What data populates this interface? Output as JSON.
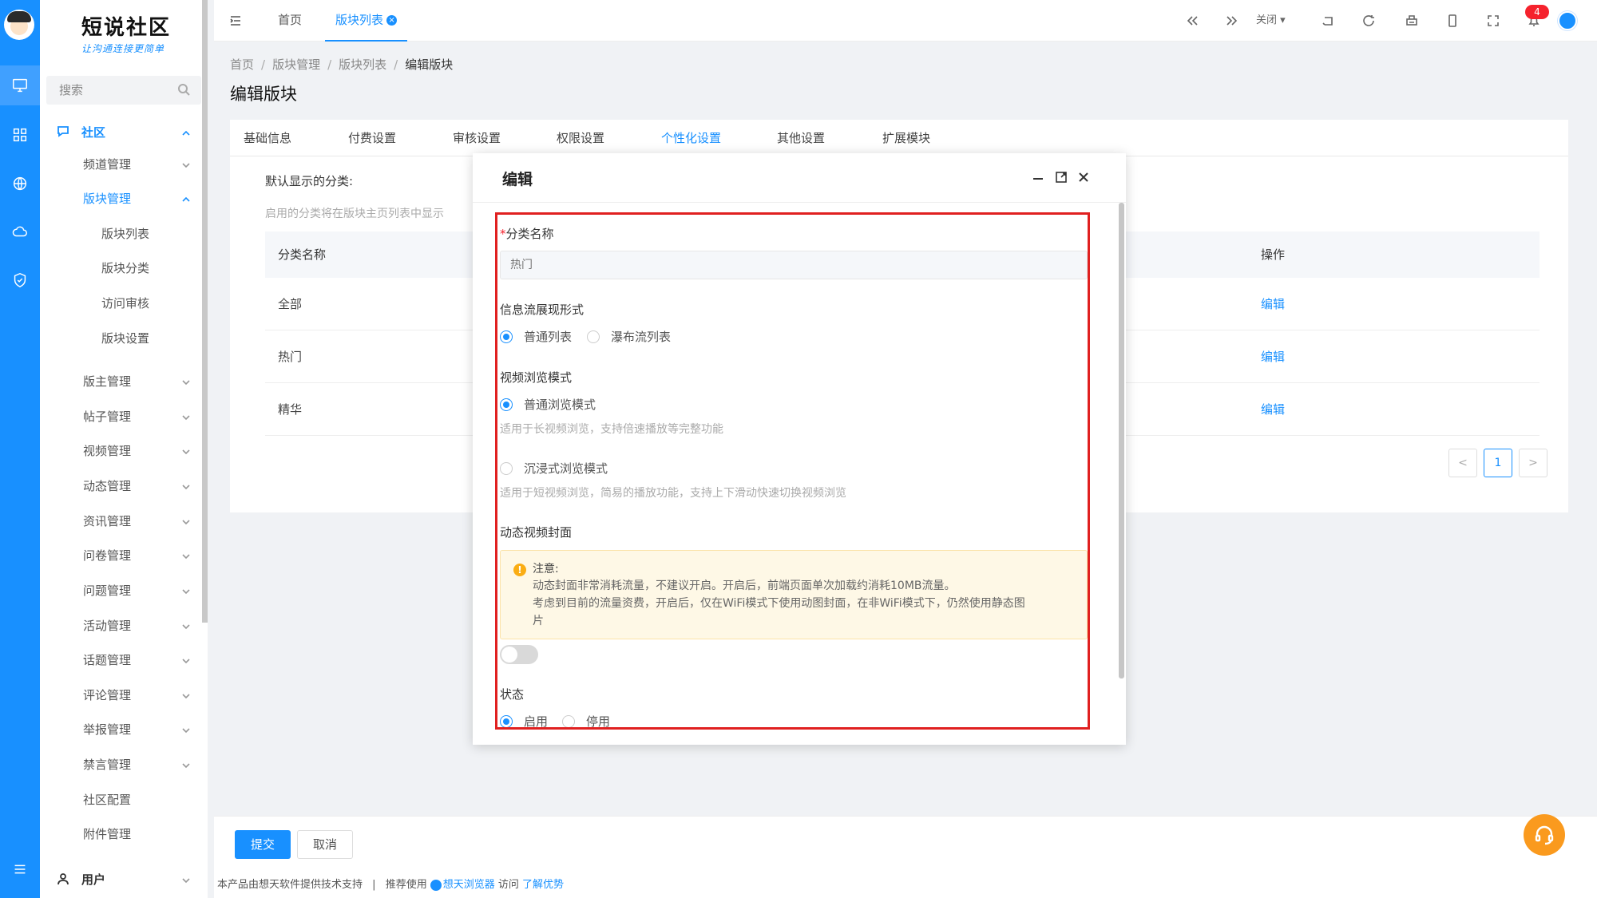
{
  "sidebar": {
    "logo_title": "短说社区",
    "logo_sub": "让沟通连接更简单",
    "search_placeholder": "搜索",
    "section": "社区",
    "items": [
      {
        "label": "频道管理"
      },
      {
        "label": "版块管理"
      },
      {
        "label": "版块列表"
      },
      {
        "label": "版块分类"
      },
      {
        "label": "访问审核"
      },
      {
        "label": "版块设置"
      },
      {
        "label": "版主管理"
      },
      {
        "label": "帖子管理"
      },
      {
        "label": "视频管理"
      },
      {
        "label": "动态管理"
      },
      {
        "label": "资讯管理"
      },
      {
        "label": "问卷管理"
      },
      {
        "label": "问题管理"
      },
      {
        "label": "活动管理"
      },
      {
        "label": "话题管理"
      },
      {
        "label": "评论管理"
      },
      {
        "label": "举报管理"
      },
      {
        "label": "禁言管理"
      },
      {
        "label": "社区配置"
      },
      {
        "label": "附件管理"
      },
      {
        "label": "用户"
      }
    ]
  },
  "topbar": {
    "tabs": [
      {
        "label": "首页"
      },
      {
        "label": "版块列表"
      }
    ],
    "close_label": "关闭",
    "notification_count": "4"
  },
  "content": {
    "breadcrumb": [
      "首页",
      "版块管理",
      "版块列表",
      "编辑版块"
    ],
    "page_title": "编辑版块",
    "tabs": [
      "基础信息",
      "付费设置",
      "审核设置",
      "权限设置",
      "个性化设置",
      "其他设置",
      "扩展模块"
    ],
    "default_label": "默认显示的分类:",
    "default_hint": "启用的分类将在版块主页列表中显示",
    "table": {
      "headers": [
        "分类名称",
        "操作"
      ],
      "rows": [
        {
          "name": "全部",
          "action": "编辑"
        },
        {
          "name": "热门",
          "action": "编辑"
        },
        {
          "name": "精华",
          "action": "编辑"
        }
      ]
    },
    "pager": {
      "prev": "<",
      "page": "1",
      "next": ">"
    }
  },
  "modal": {
    "title": "编辑",
    "field_name_label": "分类名称",
    "field_name_required": "*",
    "field_name_placeholder": "热门",
    "feed_label": "信息流展现形式",
    "feed_options": [
      "普通列表",
      "瀑布流列表"
    ],
    "video_label": "视频浏览模式",
    "video_options": [
      {
        "label": "普通浏览模式",
        "hint": "适用于长视频浏览，支持倍速播放等完整功能"
      },
      {
        "label": "沉浸式浏览模式",
        "hint": "适用于短视频浏览，简易的播放功能，支持上下滑动快速切换视频浏览"
      }
    ],
    "cover_label": "动态视频封面",
    "notice_title": "注意:",
    "notice_lines": [
      "动态封面非常消耗流量，不建议开启。开启后，前端页面单次加载约消耗10MB流量。",
      "考虑到目前的流量资费，开启后，仅在WiFi模式下使用动图封面，在非WiFi模式下，仍然使用静态图",
      "片"
    ],
    "cover_enabled": false,
    "status_label": "状态",
    "status_options": [
      "启用",
      "停用"
    ]
  },
  "actions": {
    "submit": "提交",
    "cancel": "取消"
  },
  "footer": {
    "text1": "本产品由想天软件提供技术支持",
    "sep": "|",
    "text2": "推荐使用",
    "browser": "想天浏览器",
    "text3": "访问",
    "link": "了解优势"
  },
  "colors": {
    "primary": "#1890ff",
    "danger": "#f5222d",
    "warning": "#faad14",
    "support": "#fa9a1e"
  }
}
